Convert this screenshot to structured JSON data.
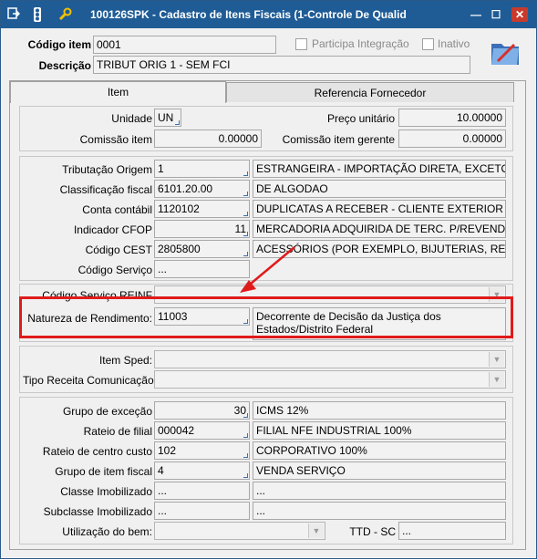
{
  "window": {
    "title": "100126SPK - Cadastro de Itens Fiscais (1-Controle De Qualid",
    "minimize_glyph": "—",
    "maximize_glyph": "☐",
    "close_glyph": "✕"
  },
  "header": {
    "codigo_item_label": "Código item",
    "codigo_item_value": "0001",
    "participa_label": "Participa Integração",
    "inativo_label": "Inativo",
    "descricao_label": "Descrição",
    "descricao_value": "TRIBUT ORIG 1 - SEM FCI"
  },
  "tabs": [
    {
      "label": "Item"
    },
    {
      "label": "Referencia Fornecedor"
    }
  ],
  "group1": {
    "unidade_label": "Unidade",
    "unidade_value": "UN",
    "preco_label": "Preço unitário",
    "preco_value": "10.00000",
    "comissao_label": "Comissão item",
    "comissao_value": "0.00000",
    "comissao_gerente_label": "Comissão item gerente",
    "comissao_gerente_value": "0.00000"
  },
  "group2": {
    "rows": [
      {
        "label": "Tributação Origem",
        "code": "1",
        "desc": "ESTRANGEIRA - IMPORTAÇÃO DIRETA, EXCETO A IND"
      },
      {
        "label": "Classificação fiscal",
        "code": "6101.20.00",
        "desc": "DE ALGODAO"
      },
      {
        "label": "Conta contábil",
        "code": "1120102",
        "desc": "DUPLICATAS A RECEBER - CLIENTE EXTERIOR"
      },
      {
        "label": "Indicador CFOP",
        "code": "11",
        "desc": "MERCADORIA ADQUIRIDA DE TERC. P/REVENDA"
      },
      {
        "label": "Código CEST",
        "code": "2805800",
        "desc": "ACESSÓRIOS (POR EXEMPLO, BIJUTERIAS, RELÓGIOS"
      },
      {
        "label": "Código Serviço",
        "code": "..."
      }
    ]
  },
  "group3": {
    "reinf_label": "Código Serviço REINF",
    "natureza_label": "Natureza de Rendimento:",
    "natureza_code": "11003",
    "natureza_desc": "Decorrente de Decisão da Justiça dos Estados/Distrito Federal"
  },
  "group4": {
    "item_sped_label": "Item Sped:",
    "tipo_receita_label": "Tipo Receita Comunicação:"
  },
  "group5": {
    "rows": [
      {
        "label": "Grupo de exceção",
        "code": "30",
        "desc": "ICMS 12%"
      },
      {
        "label": "Rateio de filial",
        "code": "000042",
        "desc": "FILIAL NFE INDUSTRIAL 100%"
      },
      {
        "label": "Rateio de centro custo",
        "code": "102",
        "desc": "CORPORATIVO 100%"
      },
      {
        "label": "Grupo de item fiscal",
        "code": "4",
        "desc": "VENDA SERVIÇO"
      },
      {
        "label": "Classe Imobilizado",
        "code": "...",
        "desc": "..."
      },
      {
        "label": "Subclasse Imobilizado",
        "code": "...",
        "desc": "..."
      }
    ],
    "utilizacao_label": "Utilização do bem:",
    "ttd_label": "TTD - SC",
    "ttd_value": "..."
  },
  "colors": {
    "titlebar": "#1f5c96",
    "highlight": "#e01b1b",
    "field_bg": "#f2f2f2"
  }
}
